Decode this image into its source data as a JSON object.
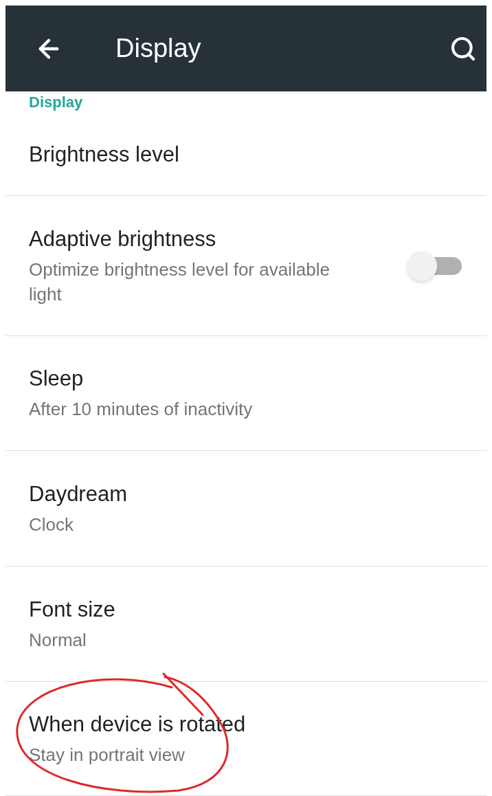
{
  "app_bar": {
    "title": "Display"
  },
  "section_header": "Display",
  "settings": [
    {
      "kind": "plain",
      "title": "Brightness level"
    },
    {
      "kind": "toggle",
      "title": "Adaptive brightness",
      "summary": "Optimize brightness level for available light",
      "on": false
    },
    {
      "kind": "plain",
      "title": "Sleep",
      "summary": "After 10 minutes of inactivity"
    },
    {
      "kind": "plain",
      "title": "Daydream",
      "summary": "Clock"
    },
    {
      "kind": "plain",
      "title": "Font size",
      "summary": "Normal"
    },
    {
      "kind": "plain",
      "title": "When device is rotated",
      "summary": "Stay in portrait view"
    }
  ]
}
